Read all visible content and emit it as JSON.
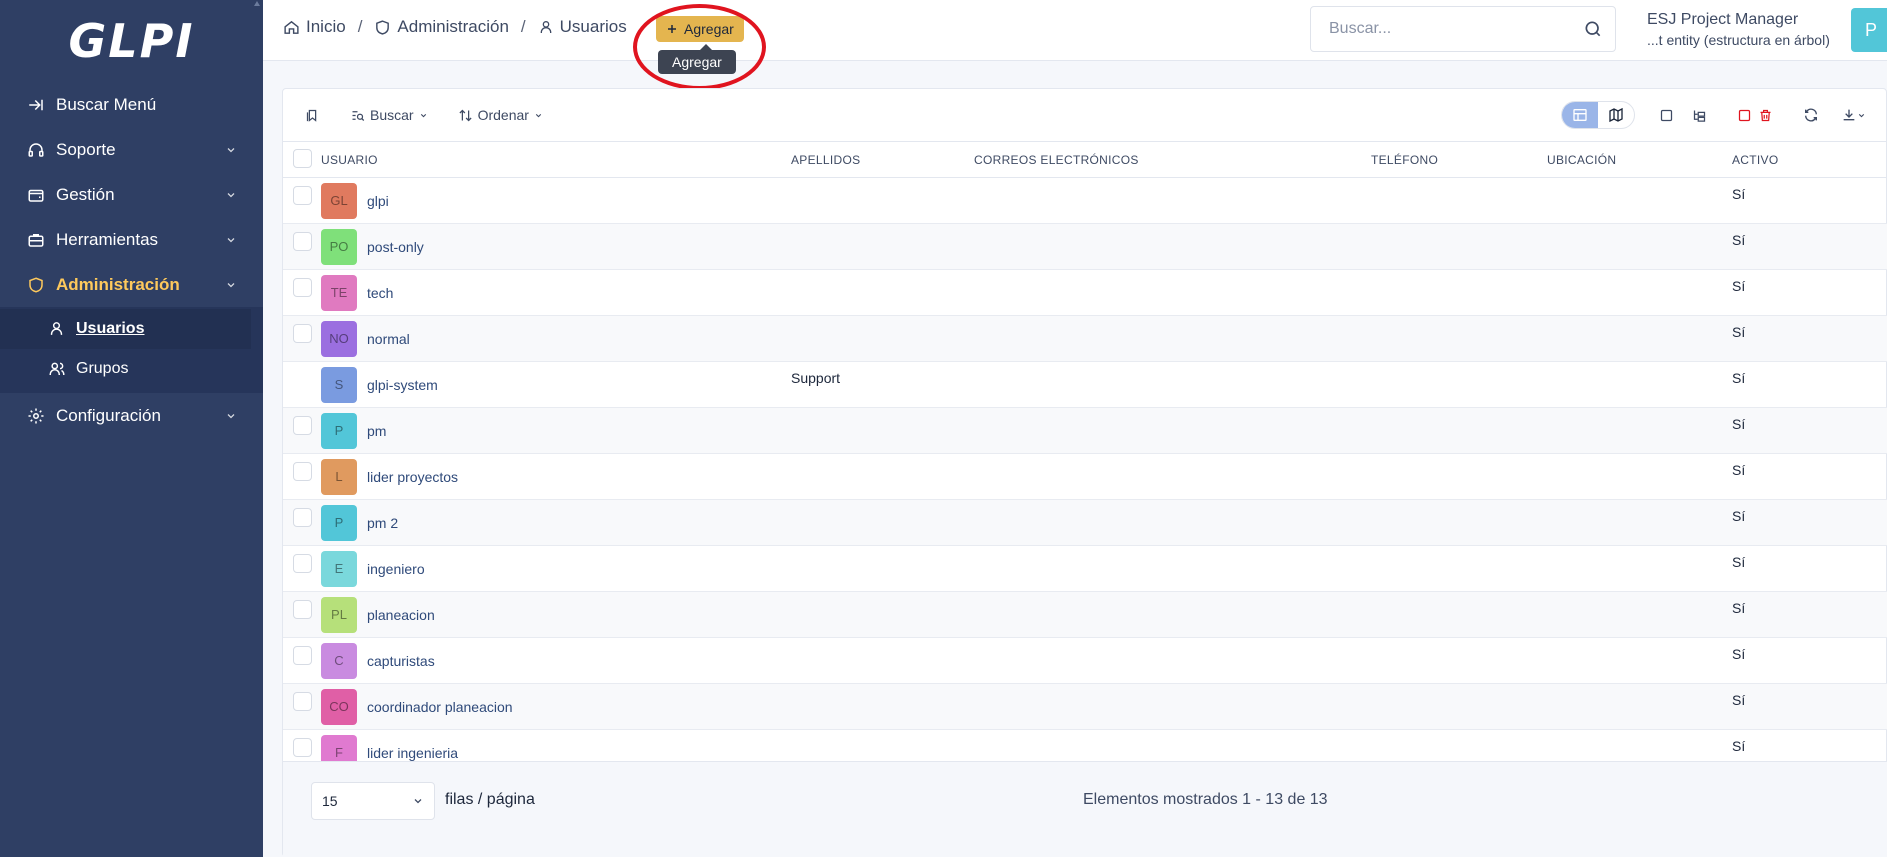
{
  "sidebar": {
    "logo": "GLPI",
    "items": [
      {
        "label": "Buscar Menú",
        "icon": "arrow-right-icon"
      },
      {
        "label": "Soporte",
        "icon": "headset-icon"
      },
      {
        "label": "Gestión",
        "icon": "wallet-icon"
      },
      {
        "label": "Herramientas",
        "icon": "briefcase-icon"
      },
      {
        "label": "Administración",
        "icon": "shield-icon"
      },
      {
        "label": "Configuración",
        "icon": "settings-icon"
      }
    ],
    "subitems": [
      {
        "label": "Usuarios",
        "icon": "user-icon"
      },
      {
        "label": "Grupos",
        "icon": "users-icon"
      }
    ]
  },
  "header": {
    "breadcrumb": [
      "Inicio",
      "Administración",
      "Usuarios"
    ],
    "add_label": "Agregar",
    "tooltip": "Agregar",
    "search_placeholder": "Buscar...",
    "user_name": "ESJ Project Manager",
    "entity": "...t entity (estructura en árbol)",
    "avatar_initial": "P"
  },
  "toolbar": {
    "search_label": "Buscar",
    "sort_label": "Ordenar"
  },
  "table": {
    "columns": [
      "USUARIO",
      "APELLIDOS",
      "CORREOS ELECTRÓNICOS",
      "TELÉFONO",
      "UBICACIÓN",
      "ACTIVO"
    ],
    "rows": [
      {
        "initials": "GL",
        "color": "#e07a5f",
        "name": "glpi",
        "surname": "",
        "active": "Sí",
        "checkbox": true
      },
      {
        "initials": "PO",
        "color": "#7fe07a",
        "name": "post-only",
        "surname": "",
        "active": "Sí",
        "checkbox": true
      },
      {
        "initials": "TE",
        "color": "#e07ac0",
        "name": "tech",
        "surname": "",
        "active": "Sí",
        "checkbox": true
      },
      {
        "initials": "NO",
        "color": "#9b6fe0",
        "name": "normal",
        "surname": "",
        "active": "Sí",
        "checkbox": true
      },
      {
        "initials": "S",
        "color": "#7a9be0",
        "name": "glpi-system",
        "surname": "Support",
        "active": "Sí",
        "checkbox": false
      },
      {
        "initials": "P",
        "color": "#52c6d8",
        "name": "pm",
        "surname": "",
        "active": "Sí",
        "checkbox": true
      },
      {
        "initials": "L",
        "color": "#e09a5f",
        "name": "lider proyectos",
        "surname": "",
        "active": "Sí",
        "checkbox": true
      },
      {
        "initials": "P",
        "color": "#52c6d8",
        "name": "pm 2",
        "surname": "",
        "active": "Sí",
        "checkbox": true
      },
      {
        "initials": "E",
        "color": "#7ad8dc",
        "name": "ingeniero",
        "surname": "",
        "active": "Sí",
        "checkbox": true
      },
      {
        "initials": "PL",
        "color": "#b6e07a",
        "name": "planeacion",
        "surname": "",
        "active": "Sí",
        "checkbox": true
      },
      {
        "initials": "C",
        "color": "#c98be0",
        "name": "capturistas",
        "surname": "",
        "active": "Sí",
        "checkbox": true
      },
      {
        "initials": "CO",
        "color": "#e05fa6",
        "name": "coordinador planeacion",
        "surname": "",
        "active": "Sí",
        "checkbox": true
      },
      {
        "initials": "F",
        "color": "#e07ad0",
        "name": "lider ingenieria",
        "surname": "",
        "active": "Sí",
        "checkbox": true
      }
    ]
  },
  "footer": {
    "rows_per_page_value": "15",
    "rows_per_page_label": "filas / página",
    "pager_info": "Elementos mostrados 1 - 13 de 13"
  },
  "colors": {
    "sidebar_bg": "#2f3f64",
    "accent": "#fec95c",
    "add_button": "#e4b54f",
    "highlight_ring": "#e0141f"
  }
}
